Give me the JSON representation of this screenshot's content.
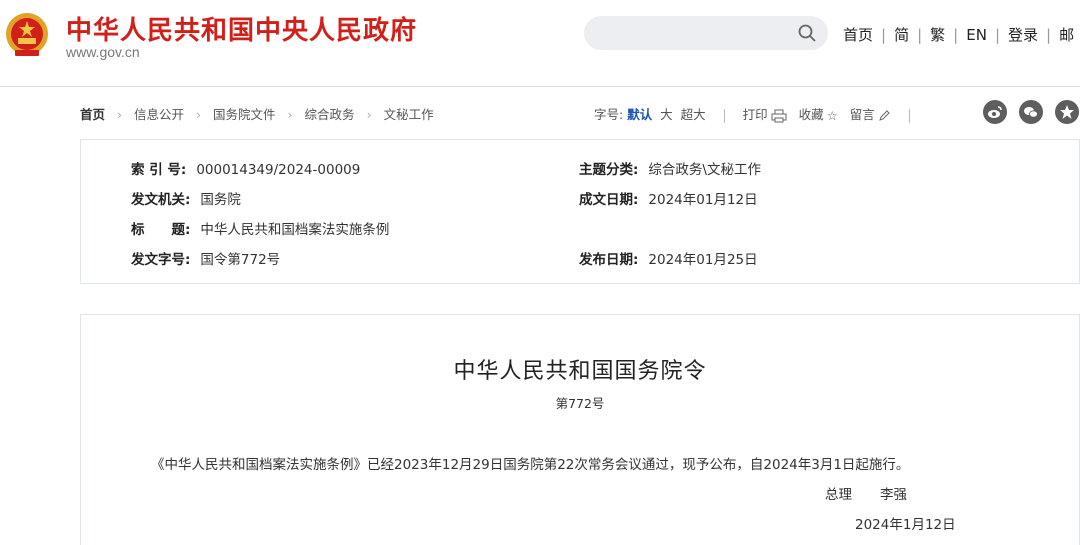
{
  "header": {
    "site_title": "中华人民共和国中央人民政府",
    "site_url": "www.gov.cn",
    "search_placeholder": "",
    "nav": [
      "首页",
      "简",
      "繁",
      "EN",
      "登录",
      "邮"
    ],
    "colors": {
      "brand_red": "#d1201a",
      "accent_blue": "#1a56b0"
    }
  },
  "breadcrumb": [
    "首页",
    "信息公开",
    "国务院文件",
    "综合政务",
    "文秘工作"
  ],
  "toolbar": {
    "font_label": "字号:",
    "font_sizes": [
      "默认",
      "大",
      "超大"
    ],
    "font_active": "默认",
    "print_label": "打印",
    "favorite_label": "收藏",
    "comment_label": "留言",
    "share_icons": [
      "weibo-icon",
      "wechat-icon",
      "favorite-star-icon"
    ]
  },
  "meta": {
    "index_label": "索 引 号:",
    "index_value": "000014349/2024-00009",
    "topic_label": "主题分类:",
    "topic_value": "综合政务\\文秘工作",
    "issuer_label": "发文机关:",
    "issuer_value": "国务院",
    "created_label": "成文日期:",
    "created_value": "2024年01月12日",
    "title_label": "标　　题:",
    "title_value": "中华人民共和国档案法实施条例",
    "docno_label": "发文字号:",
    "docno_value": "国令第772号",
    "published_label": "发布日期:",
    "published_value": "2024年01月25日"
  },
  "document": {
    "title": "中华人民共和国国务院令",
    "number": "第772号",
    "body": "《中华人民共和国档案法实施条例》已经2023年12月29日国务院第22次常务会议通过，现予公布，自2024年3月1日起施行。",
    "signer_role": "总理",
    "signer_name": "李强",
    "date": "2024年1月12日"
  }
}
